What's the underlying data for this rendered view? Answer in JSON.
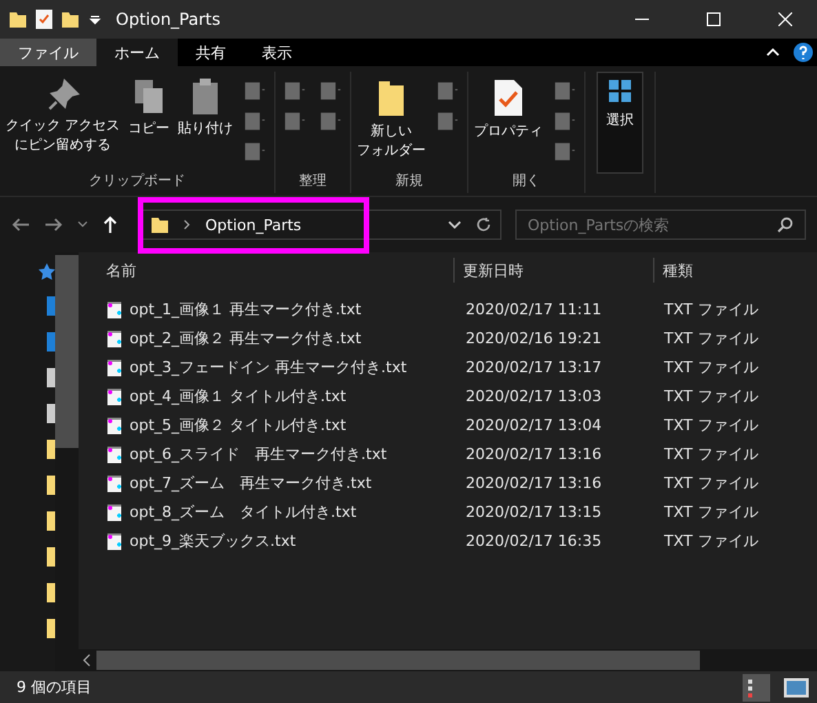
{
  "window": {
    "title": "Option_Parts"
  },
  "ribbon": {
    "tabs": [
      {
        "label": "ファイル",
        "kind": "file",
        "selected": false
      },
      {
        "label": "ホーム",
        "kind": "tab",
        "selected": true
      },
      {
        "label": "共有",
        "kind": "tab",
        "selected": false
      },
      {
        "label": "表示",
        "kind": "tab",
        "selected": false
      }
    ],
    "groups": [
      {
        "label": "クリップボード",
        "buttons": [
          {
            "lines": [
              "クイック アクセス",
              "にピン留めする"
            ],
            "kind": "pin"
          },
          {
            "lines": [
              "コピー"
            ],
            "kind": "copy"
          },
          {
            "lines": [
              "貼り付け"
            ],
            "kind": "paste"
          }
        ]
      },
      {
        "label": "整理"
      },
      {
        "label": "新規",
        "buttons": [
          {
            "lines": [
              "新しい",
              "フォルダー"
            ],
            "kind": "folder"
          }
        ]
      },
      {
        "label": "開く",
        "buttons": [
          {
            "lines": [
              "プロパティ"
            ],
            "kind": "props"
          }
        ]
      },
      {
        "buttons": [
          {
            "lines": [
              "選択"
            ],
            "kind": "select"
          }
        ]
      }
    ]
  },
  "address": {
    "path": "Option_Parts",
    "search_placeholder": "Option_Partsの検索"
  },
  "table": {
    "columns": [
      "名前",
      "更新日時",
      "種類"
    ],
    "rows": [
      [
        "opt_1_画像１ 再生マーク付き.txt",
        "2020/02/17 11:11",
        "TXT ファイル"
      ],
      [
        "opt_2_画像２ 再生マーク付き.txt",
        "2020/02/16 19:21",
        "TXT ファイル"
      ],
      [
        "opt_3_フェードイン 再生マーク付き.txt",
        "2020/02/17 13:17",
        "TXT ファイル"
      ],
      [
        "opt_4_画像１ タイトル付き.txt",
        "2020/02/17 13:03",
        "TXT ファイル"
      ],
      [
        "opt_5_画像２ タイトル付き.txt",
        "2020/02/17 13:04",
        "TXT ファイル"
      ],
      [
        "opt_6_スライド　再生マーク付き.txt",
        "2020/02/17 13:16",
        "TXT ファイル"
      ],
      [
        "opt_7_ズーム　再生マーク付き.txt",
        "2020/02/17 13:16",
        "TXT ファイル"
      ],
      [
        "opt_8_ズーム　タイトル付き.txt",
        "2020/02/17 13:15",
        "TXT ファイル"
      ],
      [
        "opt_9_楽天ブックス.txt",
        "2020/02/17 16:35",
        "TXT ファイル"
      ]
    ]
  },
  "status_bar": {
    "count": "9 個の項目"
  }
}
